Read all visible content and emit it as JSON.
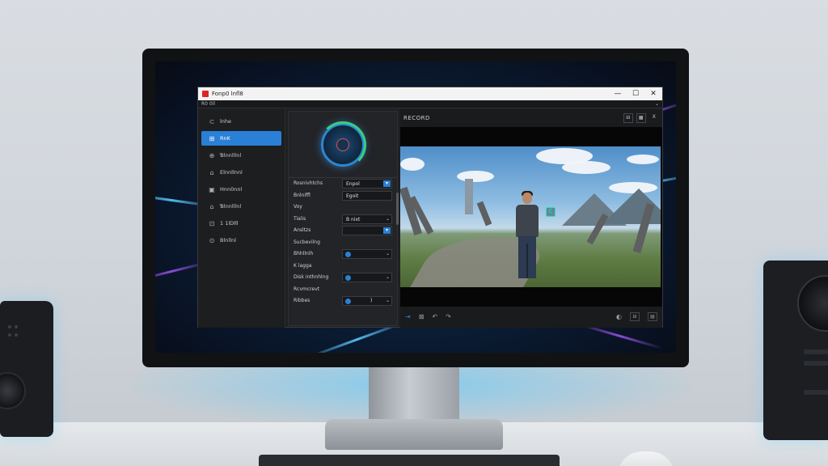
{
  "window": {
    "title": "Fonp0 lnfl8",
    "minimize": "—",
    "maximize": "☐",
    "close": "✕"
  },
  "menubar": {
    "left": "R0 0ll",
    "right": "⌄"
  },
  "sidebar": {
    "items": [
      {
        "icon": "⊂",
        "label": "lnhe",
        "active": false
      },
      {
        "icon": "⊞",
        "label": "RnK",
        "active": true
      },
      {
        "icon": "⊕",
        "label": "Ɓlnnlllnl",
        "active": false
      },
      {
        "icon": "⌂",
        "label": "Elnnllnnl",
        "active": false
      },
      {
        "icon": "▣",
        "label": "Hnn0nnl",
        "active": false
      },
      {
        "icon": "⌂",
        "label": "Ɓlnnlllnl",
        "active": false
      },
      {
        "icon": "⊡",
        "label": "1 1lDlll",
        "active": false
      },
      {
        "icon": "⊙",
        "label": "Blnllnl",
        "active": false
      }
    ]
  },
  "settings": {
    "rows": [
      {
        "label": "Rosnivhtchs",
        "value": "Enpol",
        "control": "dropdown-blue"
      },
      {
        "label": "Bnlniffl",
        "value": "Egoit",
        "control": "text"
      },
      {
        "label": "Voy",
        "value": "",
        "control": "none"
      },
      {
        "label": "Tialis",
        "value": "B nixt",
        "control": "dropdown"
      },
      {
        "label": "Ansltzs",
        "value": "",
        "control": "dropdown-blue"
      },
      {
        "label": "Sucbevilng",
        "value": "",
        "control": "none"
      },
      {
        "label": "Bhhllnlh",
        "value": "",
        "control": "toggle"
      },
      {
        "label": "K lagga",
        "value": "",
        "control": "none"
      },
      {
        "label": "Disk inthnhlng",
        "value": "",
        "control": "toggle"
      },
      {
        "label": "Rcvmcrevt",
        "value": "",
        "control": "none"
      },
      {
        "label": "Ribbes",
        "value": ")",
        "control": "toggle"
      }
    ]
  },
  "viewer": {
    "title": "RECORD",
    "head_buttons": [
      "⊟",
      "▦",
      "X"
    ],
    "foot_left": [
      "⇥",
      "⊠",
      "↶",
      "↷"
    ],
    "foot_right": [
      "◐",
      "⊟",
      "▤"
    ],
    "marker": "C"
  }
}
